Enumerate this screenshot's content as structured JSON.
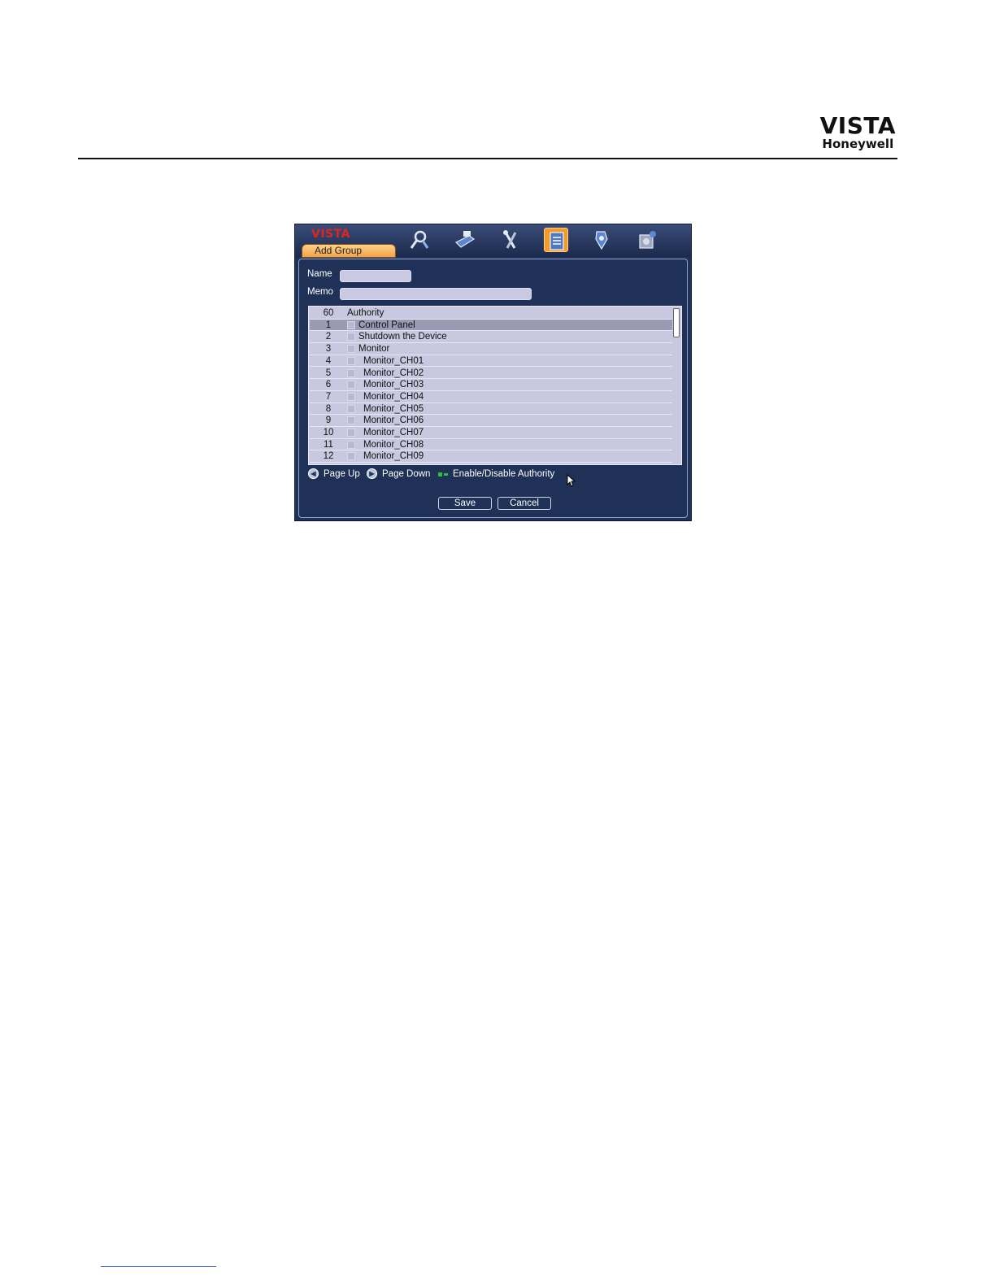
{
  "page": {
    "logo_main": "VISTA",
    "logo_sub": "Honeywell"
  },
  "dvr": {
    "brand": "VISTA",
    "tab_label": "Add Group",
    "toolbar_icons": [
      "search-icon",
      "record-icon",
      "tools-icon",
      "info-icon",
      "advanced-icon",
      "disk-icon"
    ],
    "active_icon": "info-icon",
    "name_label": "Name",
    "name_value": "",
    "memo_label": "Memo",
    "memo_value": "",
    "authority": {
      "count": "60",
      "header": "Authority",
      "rows": [
        {
          "num": "1",
          "label": "Control Panel"
        },
        {
          "num": "2",
          "label": "Shutdown the Device"
        },
        {
          "num": "3",
          "label": "Monitor"
        },
        {
          "num": "4",
          "label": "Monitor_CH01"
        },
        {
          "num": "5",
          "label": "Monitor_CH02"
        },
        {
          "num": "6",
          "label": "Monitor_CH03"
        },
        {
          "num": "7",
          "label": "Monitor_CH04"
        },
        {
          "num": "8",
          "label": "Monitor_CH05"
        },
        {
          "num": "9",
          "label": "Monitor_CH06"
        },
        {
          "num": "10",
          "label": "Monitor_CH07"
        },
        {
          "num": "11",
          "label": "Monitor_CH08"
        },
        {
          "num": "12",
          "label": "Monitor_CH09"
        }
      ],
      "selected_row": "1"
    },
    "hints": {
      "page_up": "Page Up",
      "page_down": "Page Down",
      "toggle": "Enable/Disable Authority"
    },
    "buttons": {
      "save": "Save",
      "cancel": "Cancel"
    },
    "colors": {
      "background": "#1f3156",
      "brand": "#e0261c",
      "tab": "#f0a34a",
      "list": "#c8c8e0"
    }
  }
}
